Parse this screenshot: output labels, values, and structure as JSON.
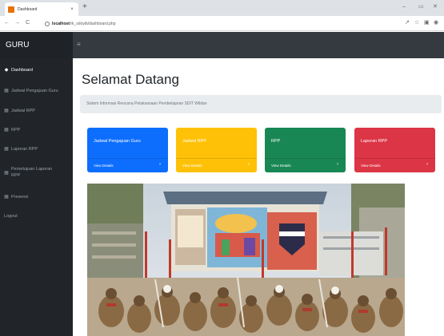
{
  "browser": {
    "tab_title": "Dashboard",
    "tab_close": "×",
    "new_tab": "+",
    "back": "←",
    "forward": "→",
    "reload": "C",
    "url_host": "localhost",
    "url_path": "/rk_sdoyib/dashboard.php",
    "minimize": "–",
    "maximize": "▭",
    "close": "✕",
    "share_icon": "↗",
    "star_icon": "☆",
    "panel_icon": "▣",
    "profile_icon": "◉"
  },
  "app": {
    "brand": "GURU",
    "menu_toggle": "≡"
  },
  "sidebar": {
    "items": [
      {
        "icon": "◆",
        "label": "Dashboard",
        "active": true
      },
      {
        "icon": "▦",
        "label": "Jadwal Pengajuan Guru"
      },
      {
        "icon": "▦",
        "label": "Jadwal RPP"
      },
      {
        "icon": "▦",
        "label": "RPP"
      },
      {
        "icon": "▦",
        "label": "Laporan RPP"
      },
      {
        "icon": "▦",
        "label": "Persetujuan Laporan RPP"
      },
      {
        "icon": "▦",
        "label": "Presensi"
      },
      {
        "icon": "",
        "label": "Logout"
      }
    ]
  },
  "main": {
    "title": "Selamat Datang",
    "subtitle": "Sistem Informasi Rencana Pelaksanaan Pembelajaran SDIT Wildan",
    "cards": [
      {
        "title": "Jadwal Pengajuan Guru",
        "link": "View Details",
        "chevron": "›",
        "color": "#0d6efd"
      },
      {
        "title": "Jadwal RPP",
        "link": "View Details",
        "chevron": "›",
        "color": "#ffc107"
      },
      {
        "title": "RPP",
        "link": "View Details",
        "chevron": "›",
        "color": "#198754"
      },
      {
        "title": "Laporan RPP",
        "link": "View Details",
        "chevron": "›",
        "color": "#dc3545"
      }
    ]
  }
}
